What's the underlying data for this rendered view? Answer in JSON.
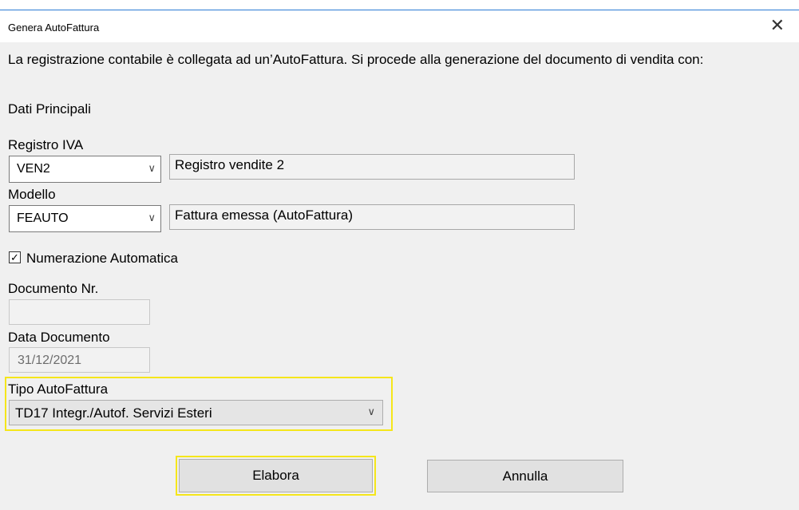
{
  "dialog": {
    "title": "Genera AutoFattura",
    "close_glyph": "✕"
  },
  "message": "La registrazione contabile è collegata ad un’AutoFattura. Si procede alla generazione del documento di vendita con:",
  "section_title": "Dati Principali",
  "registro_iva": {
    "label": "Registro IVA",
    "code": "VEN2",
    "description": "Registro vendite 2"
  },
  "modello": {
    "label": "Modello",
    "code": "FEAUTO",
    "description": "Fattura emessa (AutoFattura)"
  },
  "numerazione": {
    "label": "Numerazione Automatica",
    "checked": true,
    "check_glyph": "✓"
  },
  "documento_nr": {
    "label": "Documento Nr.",
    "value": ""
  },
  "data_documento": {
    "label": "Data Documento",
    "value": "31/12/2021"
  },
  "tipo_autofattura": {
    "label": "Tipo AutoFattura",
    "value": "TD17 Integr./Autof. Servizi Esteri"
  },
  "buttons": {
    "elabora": "Elabora",
    "annulla": "Annulla"
  },
  "icons": {
    "dropdown": "chevron-down-icon",
    "close": "close-icon",
    "check": "check-icon"
  },
  "colors": {
    "highlight": "#f5e61a",
    "window_bg": "#f0f0f0",
    "title_bg": "#ffffff"
  }
}
